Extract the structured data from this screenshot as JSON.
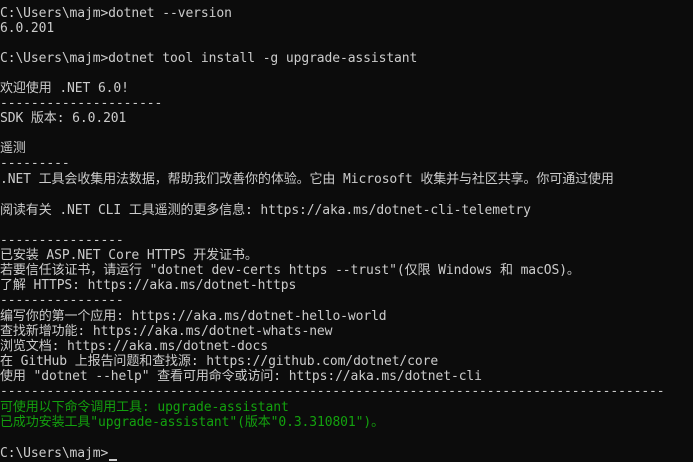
{
  "terminal": {
    "lines": [
      {
        "text": "C:\\Users\\majm>dotnet --version",
        "color": "#cccccc"
      },
      {
        "text": "6.0.201",
        "color": "#cccccc"
      },
      {
        "text": "",
        "color": "#cccccc"
      },
      {
        "text": "C:\\Users\\majm>dotnet tool install -g upgrade-assistant",
        "color": "#cccccc"
      },
      {
        "text": "",
        "color": "#cccccc"
      },
      {
        "text": "欢迎使用 .NET 6.0!",
        "color": "#cccccc"
      },
      {
        "text": "---------------------",
        "color": "#cccccc"
      },
      {
        "text": "SDK 版本: 6.0.201",
        "color": "#cccccc"
      },
      {
        "text": "",
        "color": "#cccccc"
      },
      {
        "text": "遥测",
        "color": "#cccccc"
      },
      {
        "text": "---------",
        "color": "#cccccc"
      },
      {
        "text": ".NET 工具会收集用法数据，帮助我们改善你的体验。它由 Microsoft 收集并与社区共享。你可通过使用",
        "color": "#cccccc"
      },
      {
        "text": "",
        "color": "#cccccc"
      },
      {
        "text": "阅读有关 .NET CLI 工具遥测的更多信息: https://aka.ms/dotnet-cli-telemetry",
        "color": "#cccccc"
      },
      {
        "text": "",
        "color": "#cccccc"
      },
      {
        "text": "----------------",
        "color": "#cccccc"
      },
      {
        "text": "已安装 ASP.NET Core HTTPS 开发证书。",
        "color": "#cccccc"
      },
      {
        "text": "若要信任该证书，请运行 \"dotnet dev-certs https --trust\"(仅限 Windows 和 macOS)。",
        "color": "#cccccc"
      },
      {
        "text": "了解 HTTPS: https://aka.ms/dotnet-https",
        "color": "#cccccc"
      },
      {
        "text": "----------------",
        "color": "#cccccc"
      },
      {
        "text": "编写你的第一个应用: https://aka.ms/dotnet-hello-world",
        "color": "#cccccc"
      },
      {
        "text": "查找新增功能: https://aka.ms/dotnet-whats-new",
        "color": "#cccccc"
      },
      {
        "text": "浏览文档: https://aka.ms/dotnet-docs",
        "color": "#cccccc"
      },
      {
        "text": "在 GitHub 上报告问题和查找源: https://github.com/dotnet/core",
        "color": "#cccccc"
      },
      {
        "text": "使用 \"dotnet --help\" 查看可用命令或访问: https://aka.ms/dotnet-cli",
        "color": "#cccccc"
      },
      {
        "text": "--------------------------------------------------------------------------------------",
        "color": "#cccccc"
      },
      {
        "text": "可使用以下命令调用工具: upgrade-assistant",
        "color": "#13a10e"
      },
      {
        "text": "已成功安装工具\"upgrade-assistant\"(版本\"0.3.310801\")。",
        "color": "#13a10e"
      },
      {
        "text": "",
        "color": "#cccccc"
      },
      {
        "text": "C:\\Users\\majm>",
        "color": "#cccccc"
      }
    ]
  }
}
